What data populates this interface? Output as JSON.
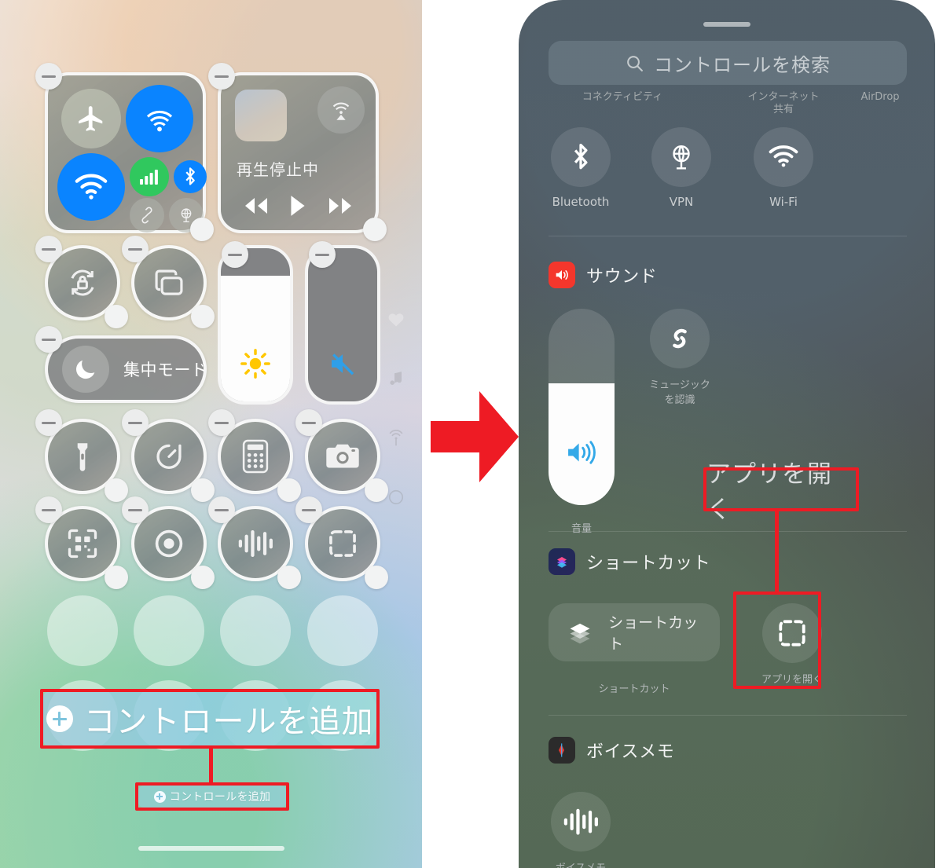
{
  "left_phone": {
    "name": "iOS Control Center edit mode",
    "modules": [
      {
        "name": "connectivity",
        "tiles": [
          "airplane-mode",
          "airdrop",
          "wifi",
          "cellular-data",
          "bluetooth",
          "personal-hotspot",
          "vpn"
        ]
      },
      {
        "name": "now-playing",
        "status_text": "再生停止中",
        "buttons": [
          "rewind",
          "play",
          "fast-forward",
          "airplay"
        ]
      },
      {
        "name": "rotation-lock"
      },
      {
        "name": "screen-mirroring"
      },
      {
        "name": "brightness-slider"
      },
      {
        "name": "volume-slider"
      },
      {
        "name": "focus-mode",
        "label": "集中モード"
      },
      {
        "name": "flashlight"
      },
      {
        "name": "timer"
      },
      {
        "name": "calculator"
      },
      {
        "name": "camera"
      },
      {
        "name": "qr-code-scanner"
      },
      {
        "name": "screen-record"
      },
      {
        "name": "voice-memo"
      },
      {
        "name": "open-app"
      }
    ],
    "page_rail": [
      "heart-icon",
      "music-note-icon",
      "connectivity-icon",
      "circle-icon"
    ],
    "add_control": {
      "label": "コントロールを追加",
      "plus_icon": "plus-circle-icon"
    }
  },
  "annotations": {
    "callout_color": "#ee1b24",
    "arrow": "right-arrow",
    "open_app_label": "アプリを開く"
  },
  "right_phone": {
    "search": {
      "placeholder": "コントロールを検索",
      "icon": "search-icon"
    },
    "top_categories": [
      "コネクティビティ",
      "インターネット\n共有",
      "AirDrop"
    ],
    "top_controls": [
      {
        "label": "Bluetooth",
        "icon": "bluetooth-icon"
      },
      {
        "label": "VPN",
        "icon": "vpn-icon"
      },
      {
        "label": "Wi-Fi",
        "icon": "wifi-icon"
      }
    ],
    "sections": [
      {
        "title": "サウンド",
        "app_icon": "sound-app-icon",
        "app_icon_color": "#f4362c",
        "items": [
          {
            "label": "音量",
            "icon": "volume-slider-icon",
            "type": "slider"
          },
          {
            "label": "ミュージック\nを認識",
            "icon": "shazam-icon",
            "type": "circle"
          }
        ]
      },
      {
        "title": "ショートカット",
        "app_icon": "shortcuts-app-icon",
        "app_icon_color": "#2b2b5e",
        "items": [
          {
            "label": "ショートカット",
            "icon": "shortcuts-icon",
            "type": "pill",
            "pill_label": "ショートカット"
          },
          {
            "label": "アプリを開く",
            "icon": "open-app-icon",
            "type": "circle"
          }
        ]
      },
      {
        "title": "ボイスメモ",
        "app_icon": "voice-memos-app-icon",
        "app_icon_color": "#2b2b2b",
        "items": [
          {
            "label": "ボイスメモ",
            "icon": "waveform-icon",
            "type": "circle"
          }
        ]
      }
    ]
  }
}
